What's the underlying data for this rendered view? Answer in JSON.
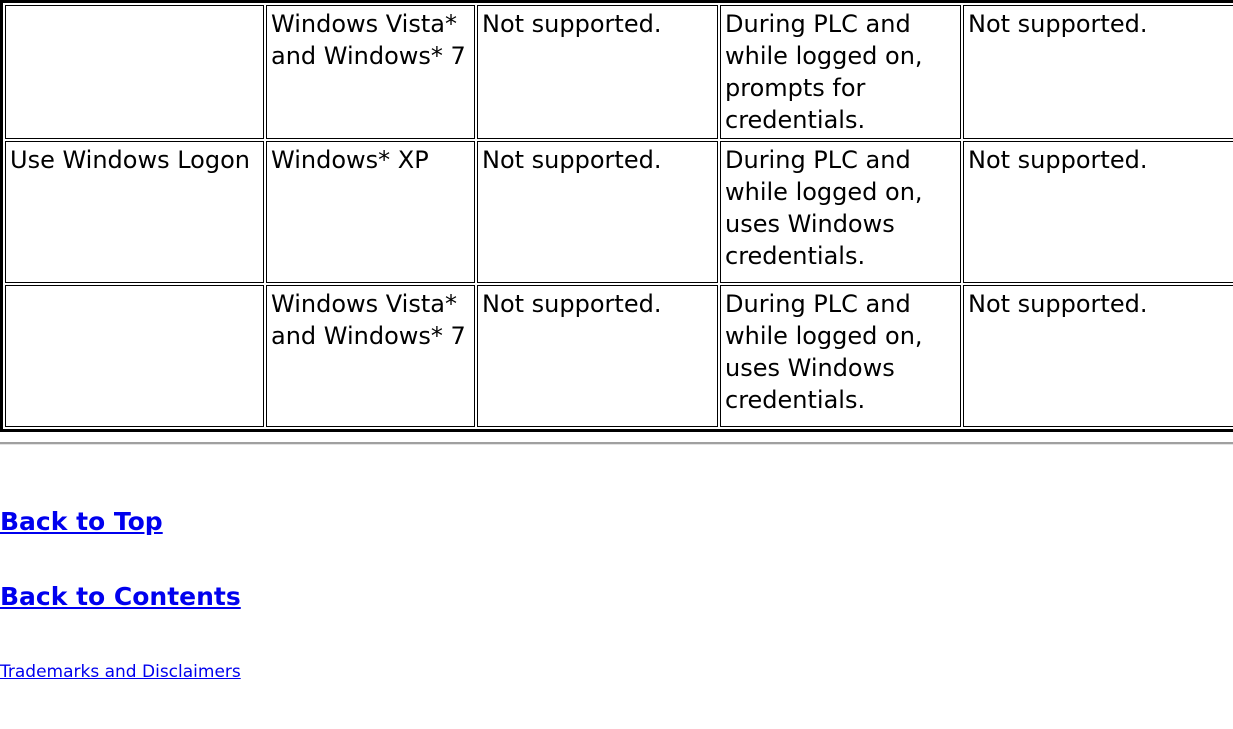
{
  "table": {
    "rows": [
      {
        "feature": "",
        "os": "Windows Vista* and Windows* 7",
        "install": "Not supported.",
        "plc": "During PLC and while logged on, prompts for credentials.",
        "last": "Not supported."
      },
      {
        "feature": "Use Windows Logon",
        "os": "Windows* XP",
        "install": "Not supported.",
        "plc": "During PLC and while logged on, uses Windows credentials.",
        "last": "Not supported."
      },
      {
        "feature": "",
        "os": "Windows Vista* and Windows* 7",
        "install": "Not supported.",
        "plc": "During PLC and while logged on, uses Windows credentials.",
        "last": "Not supported."
      }
    ]
  },
  "footer": {
    "back_to_top": "Back to Top",
    "back_to_contents": "Back to Contents",
    "trademarks": "Trademarks and Disclaimers"
  },
  "colors": {
    "link": "#0000ee",
    "border": "#000000",
    "rule": "#a0a0a0",
    "background": "#ffffff"
  }
}
